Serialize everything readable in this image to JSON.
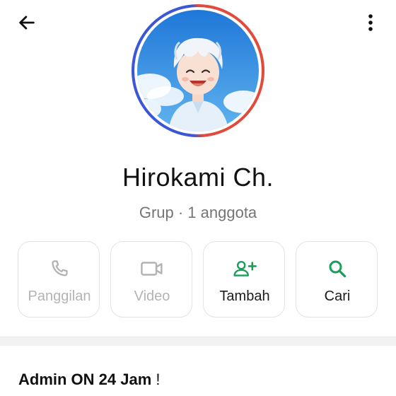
{
  "header": {
    "back_icon": "arrow-left-icon",
    "more_icon": "more-vertical-icon"
  },
  "profile": {
    "name": "Hirokami Ch.",
    "subtitle": "Grup · 1 anggota",
    "avatar": "anime-boy-sky-avatar",
    "ring_colors": [
      "#3b56d6",
      "#e04b3c"
    ]
  },
  "actions": [
    {
      "label": "Panggilan",
      "icon": "phone-icon",
      "enabled": false
    },
    {
      "label": "Video",
      "icon": "video-icon",
      "enabled": false
    },
    {
      "label": "Tambah",
      "icon": "add-person-icon",
      "enabled": true
    },
    {
      "label": "Cari",
      "icon": "search-icon",
      "enabled": true
    }
  ],
  "colors": {
    "accent": "#1a9e5a",
    "disabled": "#b3b3b3"
  },
  "description": {
    "bold": "Admin ON 24 Jam",
    "rest": " !"
  }
}
